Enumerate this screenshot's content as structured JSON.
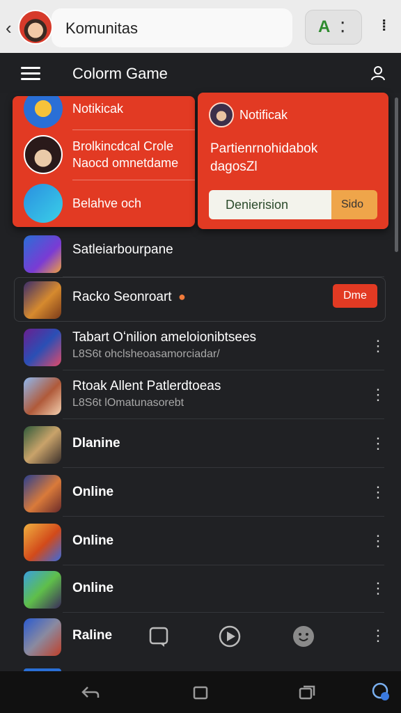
{
  "browser": {
    "url_text": "Komunitas"
  },
  "header": {
    "title": "Colorm Game"
  },
  "notification_menu": {
    "items": [
      {
        "label": "Notikicak"
      },
      {
        "label_line1": "Brolkincdcal Crole",
        "label_line2": "Naocd omnetdame"
      },
      {
        "label": "Belahve och"
      }
    ]
  },
  "notification_card": {
    "title": "Notificak",
    "body_line1": "Partienrnohidabok",
    "body_line2": "dagosZl",
    "input_value": "Denierision",
    "button_label": "Sido"
  },
  "list": [
    {
      "title": "Satleiarbourpane",
      "subtitle": ""
    },
    {
      "title": "Racko Seonroart",
      "subtitle": "",
      "action": "Dme"
    },
    {
      "title": "Tabart Oʻnilion ameloionibtsees",
      "subtitle": "L8S6t ohclsheoasamorciadar/"
    },
    {
      "title": "Rtoak Allent Patlerdtoeas",
      "subtitle": "L8S6t lOmatunasorebt"
    },
    {
      "title": "Dlanine",
      "subtitle": ""
    },
    {
      "title": "Online",
      "subtitle": ""
    },
    {
      "title": "Online",
      "subtitle": ""
    },
    {
      "title": "Online",
      "subtitle": ""
    },
    {
      "title": "Raline",
      "subtitle": ""
    }
  ],
  "colors": {
    "accent": "#e23a23",
    "background": "#202124",
    "button_orange": "#efa54a"
  }
}
